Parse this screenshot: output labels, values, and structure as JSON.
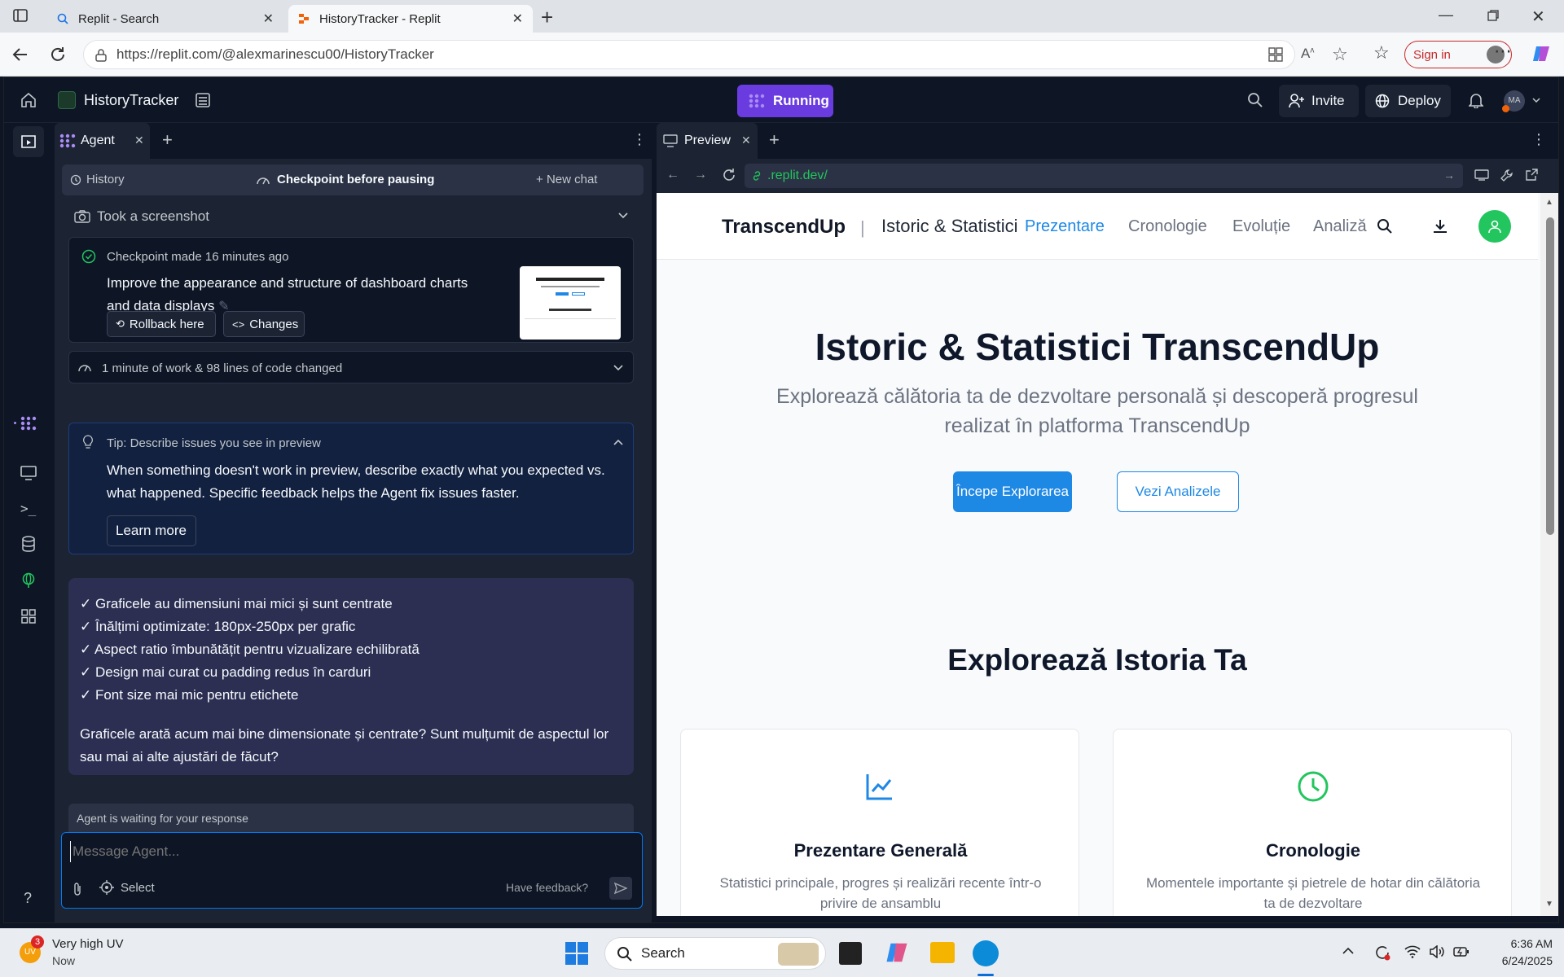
{
  "browser": {
    "tabs": [
      {
        "label": "Replit - Search",
        "active": false
      },
      {
        "label": "HistoryTracker - Replit",
        "active": true
      }
    ],
    "url": "https://replit.com/@alexmarinescu00/HistoryTracker",
    "sign_in": "Sign in"
  },
  "replit": {
    "project_name": "HistoryTracker",
    "run_status": "Running",
    "invite": "Invite",
    "deploy": "Deploy",
    "avatar": "MA",
    "left_tab": "Agent",
    "history": "History",
    "checkpoint_title": "Checkpoint before pausing",
    "new_chat": "New chat",
    "screenshot_label": "Took a screenshot",
    "checkpoint_made": "Checkpoint made 16 minutes ago",
    "checkpoint_desc": "Improve the appearance and structure of dashboard charts and data displays",
    "rollback": "Rollback here",
    "changes": "Changes",
    "work_summary": "1 minute of work & 98 lines of code changed",
    "tip_title": "Tip: Describe issues you see in preview",
    "tip_body": "When something doesn't work in preview, describe exactly what you expected vs. what happened. Specific feedback helps the Agent fix issues faster.",
    "learn_more": "Learn more",
    "message_lines": [
      "✓ Graficele au dimensiuni mai mici și sunt centrate",
      "✓ Înălțimi optimizate: 180px-250px per grafic",
      "✓ Aspect ratio îmbunătățit pentru vizualizare echilibrată",
      "✓ Design mai curat cu padding redus în carduri",
      "✓ Font size mai mic pentru etichete"
    ],
    "message_question": "Graficele arată acum mai bine dimensionate și centrate? Sunt mulțumit de aspectul lor sau mai ai alte ajustări de făcut?",
    "waiting": "Agent is waiting for your response",
    "input_placeholder": "Message Agent...",
    "select": "Select",
    "feedback": "Have feedback?",
    "right_tab": "Preview",
    "preview_url": ".replit.dev/"
  },
  "site": {
    "brand": "TranscendUp",
    "separator": "|",
    "section_title": "Istoric & Statistici",
    "nav": [
      "Prezentare",
      "Cronologie",
      "Evoluție",
      "Analiză"
    ],
    "hero_title": "Istoric & Statistici TranscendUp",
    "hero_sub_1": "Explorează călătoria ta de dezvoltare personală și descoperă progresul",
    "hero_sub_2": "realizat în platforma TranscendUp",
    "btn_primary": "Începe Explorarea",
    "btn_secondary": "Vezi Analizele",
    "section2_title": "Explorează Istoria Ta",
    "cards": [
      {
        "title": "Prezentare Generală",
        "desc_1": "Statistici principale, progres și realizări recente într-o",
        "desc_2": "privire de ansamblu",
        "icon": "chart-line-icon"
      },
      {
        "title": "Cronologie",
        "desc_1": "Momentele importante și pietrele de hotar din călătoria",
        "desc_2": "ta de dezvoltare",
        "icon": "clock-icon"
      }
    ],
    "colors": {
      "primary": "#1e88e5",
      "green": "#22c55e"
    }
  },
  "taskbar": {
    "weather_title": "Very high UV",
    "weather_sub": "Now",
    "weather_badge": "3",
    "weather_icon_text": "UV",
    "search": "Search",
    "time": "6:36 AM",
    "date": "6/24/2025"
  }
}
